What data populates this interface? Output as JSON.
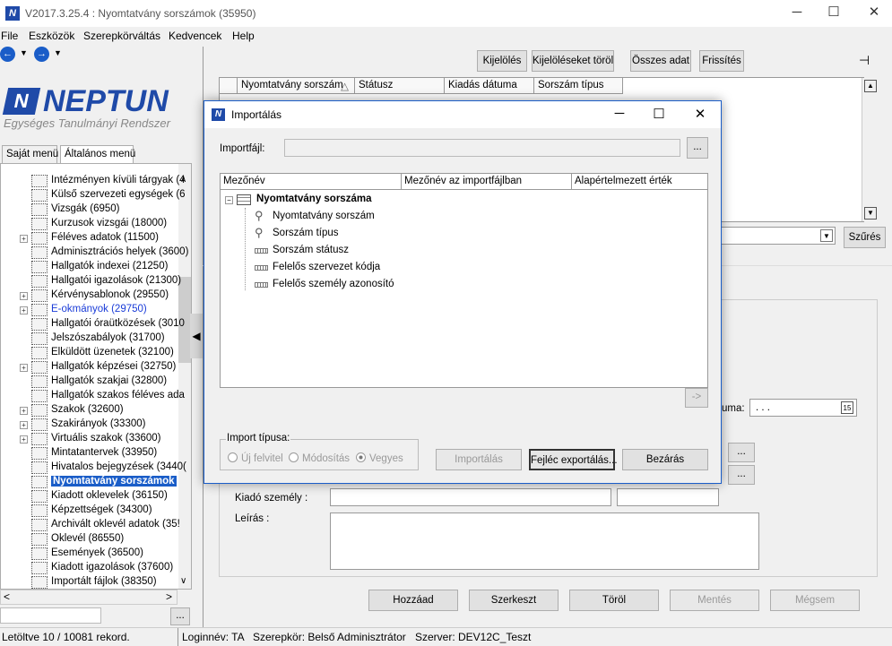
{
  "window": {
    "title": "V2017.3.25.4 : Nyomtatvány sorszámok (35950)",
    "controls": [
      "─",
      "☐",
      "✕"
    ]
  },
  "menu": [
    "File",
    "Eszközök",
    "Szerepkörváltás",
    "Kedvencek",
    "Help"
  ],
  "logo": {
    "mark": "N",
    "word": "NEPTUN",
    "subtitle": "Egységes Tanulmányi Rendszer"
  },
  "left_tabs": [
    "Saját menü",
    "Általános menü"
  ],
  "tree": [
    {
      "label": "Intézményen kívüli tárgyak (4",
      "exp": false
    },
    {
      "label": "Külső szervezeti egységek (6",
      "exp": false
    },
    {
      "label": "Vizsgák (6950)",
      "exp": false
    },
    {
      "label": "Kurzusok vizsgái (18000)",
      "exp": false
    },
    {
      "label": "Féléves adatok (11500)",
      "exp": true
    },
    {
      "label": "Adminisztrációs helyek (3600)",
      "exp": false
    },
    {
      "label": "Hallgatók indexei (21250)",
      "exp": false
    },
    {
      "label": "Hallgatói igazolások (21300)",
      "exp": false
    },
    {
      "label": "Kérvénysablonok (29550)",
      "exp": true
    },
    {
      "label": "E-okmányok (29750)",
      "exp": true,
      "link": true
    },
    {
      "label": "Hallgatói óraütközések (3010",
      "exp": false
    },
    {
      "label": "Jelszószabályok (31700)",
      "exp": false
    },
    {
      "label": "Elküldött üzenetek (32100)",
      "exp": false
    },
    {
      "label": "Hallgatók képzései (32750)",
      "exp": true
    },
    {
      "label": "Hallgatók szakjai (32800)",
      "exp": false
    },
    {
      "label": "Hallgatók szakos féléves ada",
      "exp": false
    },
    {
      "label": "Szakok (32600)",
      "exp": true
    },
    {
      "label": "Szakirányok (33300)",
      "exp": true
    },
    {
      "label": "Virtuális szakok (33600)",
      "exp": true
    },
    {
      "label": "Mintatantervek (33950)",
      "exp": false
    },
    {
      "label": "Hivatalos bejegyzések (3440(",
      "exp": false
    },
    {
      "label": "Nyomtatvány sorszámok",
      "exp": false,
      "selected": true
    },
    {
      "label": "Kiadott oklevelek (36150)",
      "exp": false
    },
    {
      "label": "Képzettségek (34300)",
      "exp": false
    },
    {
      "label": "Archivált oklevél adatok (35!",
      "exp": false
    },
    {
      "label": "Oklevél (86550)",
      "exp": false
    },
    {
      "label": "Események (36500)",
      "exp": false
    },
    {
      "label": "Kiadott igazolások (37600)",
      "exp": false
    },
    {
      "label": "Importált fájlok (38350)",
      "exp": false
    }
  ],
  "status": {
    "records": "Letöltve 10 / 10081 rekord.",
    "login": "Loginnév: TA",
    "role": "Szerepkör: Belső Adminisztrátor",
    "server": "Szerver: DEV12C_Teszt"
  },
  "toolbar": {
    "select": "Kijelölés",
    "clear_select": "Kijelöléseket töröl",
    "all_data": "Összes adat",
    "refresh": "Frissítés"
  },
  "grid": {
    "headers": [
      "Nyomtatvány sorszám",
      "Státusz",
      "Kiadás dátuma",
      "Sorszám típus"
    ],
    "sort_indicator": "△"
  },
  "filter_button": "Szűrés",
  "form": {
    "date_label": "uma:",
    "date_value": " .  .  .",
    "issuer_label": "Kiadó személy :",
    "description_label": "Leírás :",
    "ellipsis": "..."
  },
  "bottom_buttons": {
    "add": "Hozzáad",
    "edit": "Szerkeszt",
    "delete": "Töröl",
    "save": "Mentés",
    "cancel": "Mégsem"
  },
  "dialog": {
    "title": "Importálás",
    "import_file_label": "Importfájl:",
    "import_file_value": "",
    "browse": "...",
    "columns": [
      "Mezőnév",
      "Mezőnév az importfájlban",
      "Alapértelmezett érték"
    ],
    "root": "Nyomtatvány sorszáma",
    "fields": [
      {
        "label": "Nyomtatvány sorszám",
        "kind": "key"
      },
      {
        "label": "Sorszám típus",
        "kind": "key"
      },
      {
        "label": "Sorszám státusz",
        "kind": "field"
      },
      {
        "label": "Felelős szervezet kódja",
        "kind": "field"
      },
      {
        "label": "Felelős személy azonosító",
        "kind": "field"
      }
    ],
    "arrow_button": "->",
    "import_type_label": "Import típusa:",
    "radio_new": "Új felvitel",
    "radio_modify": "Módosítás",
    "radio_mixed": "Vegyes",
    "import_button": "Importálás",
    "export_header_button": "Fejléc exportálás...",
    "close_button": "Bezárás"
  }
}
